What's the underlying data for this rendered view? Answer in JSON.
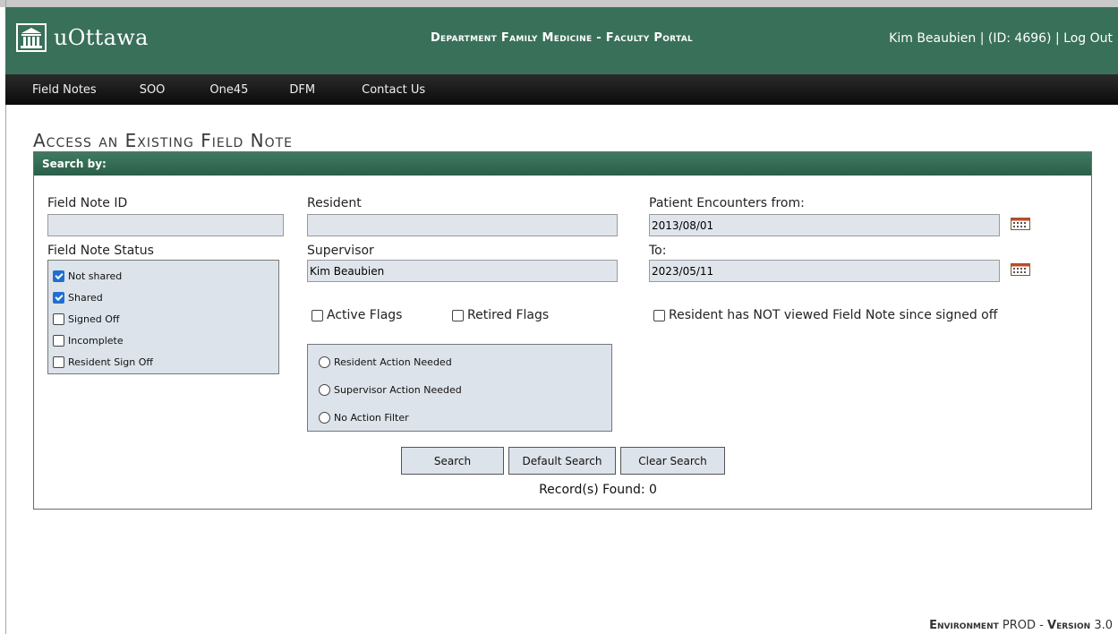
{
  "header": {
    "logo_text": "uOttawa",
    "portal_title": "Department Family Medicine - Faculty Portal",
    "user_name": "Kim Beaubien",
    "user_id": "(ID: 4696)",
    "separator": "|",
    "logout": "Log Out"
  },
  "nav": {
    "items": [
      "Field Notes",
      "SOO",
      "One45",
      "DFM",
      "Contact Us"
    ]
  },
  "page_title": "Access an Existing Field Note",
  "panel": {
    "header": "Search by:",
    "field_note_id": {
      "label": "Field Note ID",
      "value": ""
    },
    "resident": {
      "label": "Resident",
      "value": ""
    },
    "encounters_from": {
      "label": "Patient Encounters from:",
      "value": "2013/08/01"
    },
    "status": {
      "label": "Field Note Status",
      "options": [
        {
          "label": "Not shared",
          "checked": true
        },
        {
          "label": "Shared",
          "checked": true
        },
        {
          "label": "Signed Off",
          "checked": false
        },
        {
          "label": "Incomplete",
          "checked": false
        },
        {
          "label": "Resident Sign Off",
          "checked": false
        }
      ]
    },
    "supervisor": {
      "label": "Supervisor",
      "value": "Kim Beaubien"
    },
    "to": {
      "label": "To:",
      "value": "2023/05/11"
    },
    "flags": {
      "active": "Active Flags",
      "retired": "Retired Flags",
      "not_viewed": "Resident has NOT viewed Field Note since signed off"
    },
    "action_filter": {
      "options": [
        "Resident Action Needed",
        "Supervisor Action Needed",
        "No Action Filter"
      ]
    },
    "buttons": {
      "search": "Search",
      "default_search": "Default Search",
      "clear_search": "Clear Search"
    },
    "records_found": "Record(s) Found: 0"
  },
  "footer": {
    "env_label": "Environment",
    "env_value": "PROD",
    "dash": "-",
    "version_label": "Version",
    "version_value": "3.0"
  }
}
